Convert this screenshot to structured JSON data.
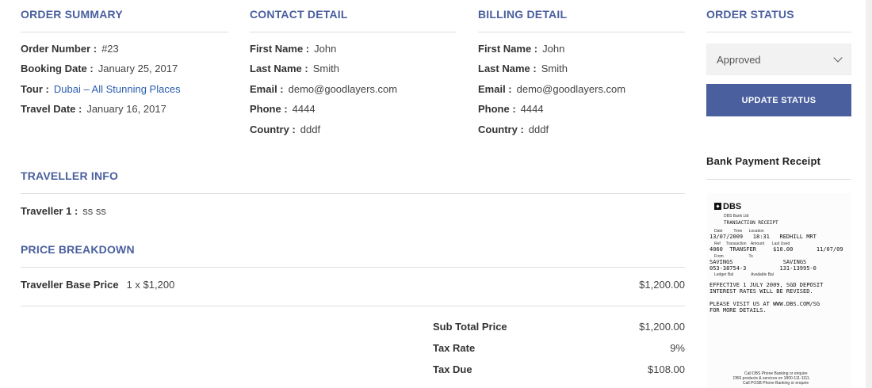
{
  "order_summary": {
    "title": "ORDER SUMMARY",
    "order_number_label": "Order Number :",
    "order_number": "#23",
    "booking_date_label": "Booking Date :",
    "booking_date": "January 25, 2017",
    "tour_label": "Tour :",
    "tour": "Dubai – All Stunning Places",
    "travel_date_label": "Travel Date :",
    "travel_date": "January 16, 2017"
  },
  "contact": {
    "title": "CONTACT DETAIL",
    "first_name_label": "First Name :",
    "first_name": "John",
    "last_name_label": "Last Name :",
    "last_name": "Smith",
    "email_label": "Email :",
    "email": "demo@goodlayers.com",
    "phone_label": "Phone :",
    "phone": "4444",
    "country_label": "Country :",
    "country": "dddf"
  },
  "billing": {
    "title": "BILLING DETAIL",
    "first_name_label": "First Name :",
    "first_name": "John",
    "last_name_label": "Last Name :",
    "last_name": "Smith",
    "email_label": "Email :",
    "email": "demo@goodlayers.com",
    "phone_label": "Phone :",
    "phone": "4444",
    "country_label": "Country :",
    "country": "dddf"
  },
  "order_status": {
    "title": "ORDER STATUS",
    "selected": "Approved",
    "update_button": "UPDATE STATUS",
    "receipt_title": "Bank Payment Receipt"
  },
  "traveller_info": {
    "title": "TRAVELLER INFO",
    "traveller_label": "Traveller 1 :",
    "traveller_value": "ss ss"
  },
  "price_breakdown": {
    "title": "PRICE BREAKDOWN",
    "base_label": "Traveller Base Price",
    "base_qty": "1 x $1,200",
    "base_amount": "$1,200.00",
    "subtotal_label": "Sub Total Price",
    "subtotal": "$1,200.00",
    "tax_rate_label": "Tax Rate",
    "tax_rate": "9%",
    "tax_due_label": "Tax Due",
    "tax_due": "$108.00"
  },
  "receipt": {
    "bank": "DBS",
    "bank_ltd": "DBS Bank Ltd",
    "heading": "TRANSACTION RECEIPT",
    "hdr1": "Date          Time      Location",
    "row1": "13/07/2009   18:31   REDHILL MRT",
    "hdr2": "Ref     Transaction    Amount       Last Used",
    "row2": "4060  TRANSFER     $10.00       11/07/09",
    "hdr3": "From                       To",
    "row3": "SAVINGS               SAVINGS",
    "row4": "053-38754-3          131-13995-0",
    "hdr4": "Ledger Bal                Available Bal",
    "note1": "EFFECTIVE 1 JULY 2009, SGD DEPOSIT",
    "note2": "INTEREST RATES WILL BE REVISED.",
    "note3": "PLEASE VISIT US AT WWW.DBS.COM/SG",
    "note4": "FOR MORE DETAILS.",
    "foot1": "Call DBS Phone Banking or enquire",
    "foot2": "DBS products & services on 1800-111-1111.",
    "foot3": "Call POSB Phone Banking or enquire"
  }
}
